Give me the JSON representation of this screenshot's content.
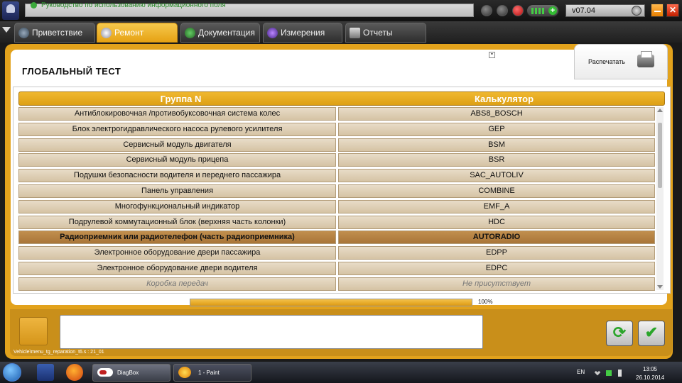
{
  "topbar": {
    "message": "Руководство по использованию информационного поля",
    "version": "v07.04",
    "close_glyph": "✕"
  },
  "tabs": [
    {
      "label": "Приветствие",
      "active": false
    },
    {
      "label": "Ремонт",
      "active": true
    },
    {
      "label": "Документация",
      "active": false
    },
    {
      "label": "Измерения",
      "active": false
    },
    {
      "label": "Отчеты",
      "active": false
    }
  ],
  "page": {
    "title": "ГЛОБАЛЬНЫЙ ТЕСТ",
    "print_label": "Распечатать"
  },
  "table": {
    "headers": [
      "Группа N",
      "Калькулятор"
    ],
    "rows": [
      {
        "group": "Антиблокировочная /противобуксовочная система колес",
        "calc": "ABS8_BOSCH",
        "state": "normal"
      },
      {
        "group": "Блок электрогидравлического насоса рулевого усилителя",
        "calc": "GEP",
        "state": "normal"
      },
      {
        "group": "Сервисный модуль двигателя",
        "calc": "BSM",
        "state": "normal"
      },
      {
        "group": "Сервисный модуль прицепа",
        "calc": "BSR",
        "state": "normal"
      },
      {
        "group": "Подушки безопасности водителя и переднего пассажира",
        "calc": "SAC_AUTOLIV",
        "state": "normal"
      },
      {
        "group": "Панель управления",
        "calc": "COMBINE",
        "state": "normal"
      },
      {
        "group": "Многофункциональный индикатор",
        "calc": "EMF_A",
        "state": "normal"
      },
      {
        "group": "Подрулевой коммутационный блок (верхняя часть колонки)",
        "calc": "HDC",
        "state": "normal"
      },
      {
        "group": "Радиоприемник или радиотелефон (часть радиоприемника)",
        "calc": "AUTORADIO",
        "state": "selected"
      },
      {
        "group": "Электронное оборудование двери пассажира",
        "calc": "EDPP",
        "state": "normal"
      },
      {
        "group": "Электронное оборудование двери водителя",
        "calc": "EDPC",
        "state": "normal"
      },
      {
        "group": "Коробка передач",
        "calc": "Не присутствует",
        "state": "dim"
      }
    ]
  },
  "progress": {
    "value": 100,
    "label": "100%"
  },
  "footer": {
    "path": "Vehicle\\menu_tg_reparation_t6.s : 21_01",
    "refresh_glyph": "⟳",
    "ok_glyph": "✔"
  },
  "taskbar": {
    "tasks": [
      {
        "label": "DiagBox"
      },
      {
        "label": "1 - Paint"
      }
    ],
    "lang": "EN",
    "time": "13:05",
    "date": "26.10.2014"
  },
  "colors": {
    "accent": "#e2a21c",
    "row_bg": "#d5c3a4",
    "row_selected": "#a97538"
  }
}
